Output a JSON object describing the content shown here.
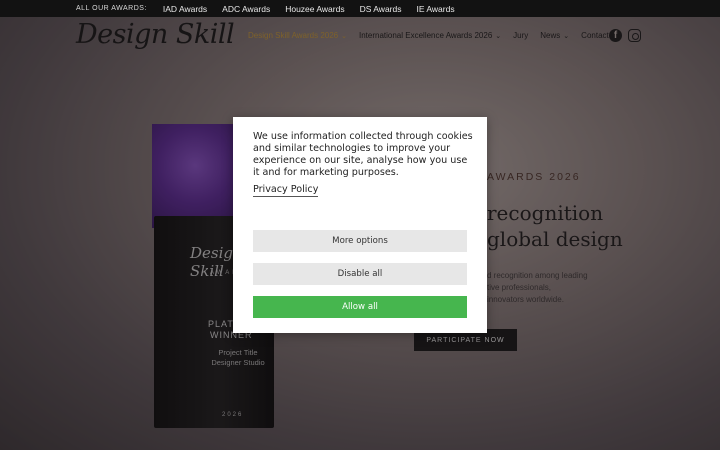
{
  "topbar": {
    "label": "ALL OUR AWARDS:",
    "links": [
      "IAD Awards",
      "ADC Awards",
      "Houzee Awards",
      "DS Awards",
      "IE Awards"
    ]
  },
  "header": {
    "logo": "Design Skill",
    "nav": [
      {
        "label": "Design Skill Awards 2026",
        "chevron": true,
        "active": true
      },
      {
        "label": "International Excellence Awards 2026",
        "chevron": true,
        "active": false
      },
      {
        "label": "Jury",
        "chevron": false,
        "active": false
      },
      {
        "label": "News",
        "chevron": true,
        "active": false
      },
      {
        "label": "Contact",
        "chevron": false,
        "active": false
      }
    ],
    "social": {
      "facebook": "f"
    }
  },
  "trophy": {
    "logo": "Design Skill",
    "awards": "AWARDS",
    "win1": "PLATINUM",
    "win2": "WINNER",
    "project": "Project Title Designer Studio",
    "year": "2026"
  },
  "hero": {
    "eyebrow": "AWARDS 2026",
    "headline1": "recognition",
    "headline2": "global design",
    "sub1": "d recognition among leading",
    "sub2": "tive professionals,",
    "sub3": "innovators worldwide.",
    "cta": "PARTICIPATE NOW"
  },
  "cookie": {
    "message": "We use information collected through cookies and similar technologies to improve your experience on our site, analyse how you use it and for marketing purposes.",
    "policy": "Privacy Policy",
    "more": "More options",
    "disable": "Disable all",
    "allow": "Allow all"
  },
  "colors": {
    "accent": "#c79a3a",
    "allow": "#46b64e"
  }
}
